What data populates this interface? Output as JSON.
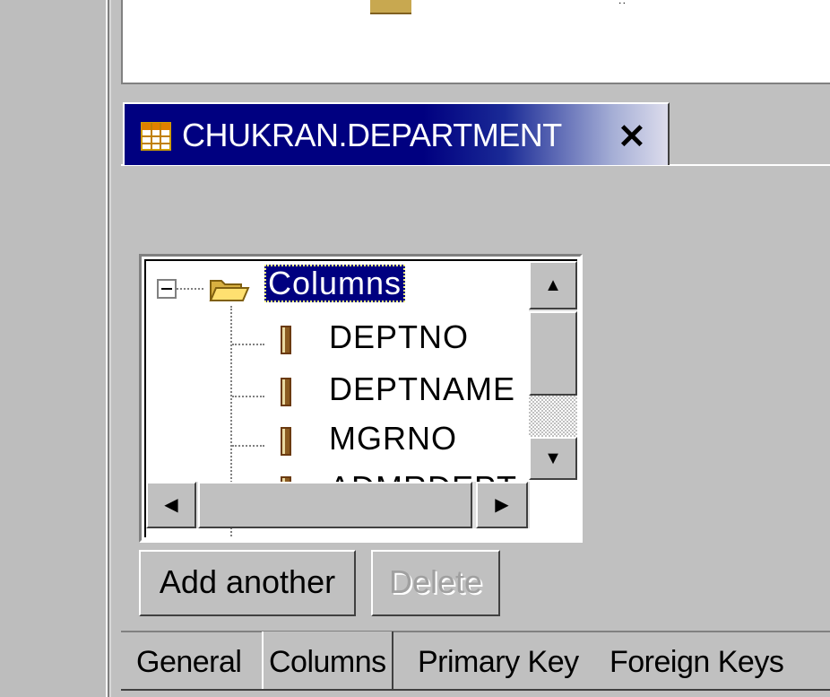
{
  "upper_panel": {
    "glyph": "˙˙"
  },
  "editor_tab": {
    "title": "CHUKRAN.DEPARTMENT",
    "close_glyph": "✕",
    "icon": "table-icon"
  },
  "tree": {
    "root_label": "Columns",
    "items": [
      "DEPTNO",
      "DEPTNAME",
      "MGRNO",
      "ADMRDEPT"
    ]
  },
  "scrollbars": {
    "up_arrow": "▲",
    "down_arrow": "▼",
    "left_arrow": "◀",
    "right_arrow": "▶"
  },
  "buttons": {
    "add_another": "Add another",
    "delete": "Delete"
  },
  "bottom_tabs": [
    "General",
    "Columns",
    "Primary Key",
    "Foreign Keys"
  ],
  "colors": {
    "selection": "#000080",
    "face": "#c0c0c0",
    "disabled_text": "#a0a0a0"
  }
}
